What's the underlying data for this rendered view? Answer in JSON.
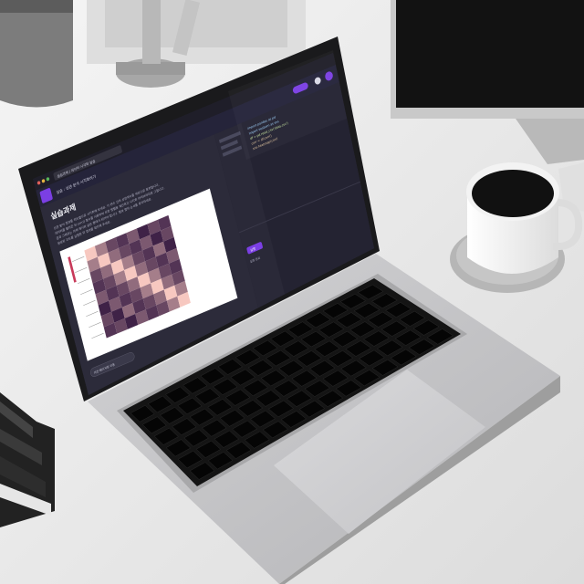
{
  "browser": {
    "tab_title": "실습과제 | 데이터 시각화 실습",
    "breadcrumb": "실습 : 상관 분석 시각화하기"
  },
  "lesson": {
    "heading": "실습과제",
    "paragraph_lines": [
      "상관 분석 결과를 히트맵으로 시각화해 보세요. 각 변수 간의 상관계수를 색상으로 표현합니다.",
      "데이터를 불러온 뒤 corr() 함수를 사용하여 상관 행렬을 계산하고 시각화 라이브러리로 그립니다.",
      "결과 그래프는 아래 예시와 같은 형태가 되어야 합니다. 행과 열의 순서를 유지하세요.",
      "완성된 코드를 실행한 뒤 결과를 확인해 주세요."
    ],
    "footer_button": "이전 페이지로 이동"
  },
  "editor": {
    "code_lines": [
      "import pandas as pd",
      "import seaborn as sns",
      "df = pd.read_csv('data.csv')",
      "corr = df.corr()",
      "sns.heatmap(corr)"
    ],
    "run_button": "실행",
    "status_text": "실행 완료"
  },
  "chart_data": {
    "type": "heatmap",
    "rows": 8,
    "cols": 8,
    "values": [
      [
        1.0,
        0.6,
        0.3,
        0.2,
        0.4,
        0.1,
        0.3,
        0.2
      ],
      [
        0.6,
        1.0,
        0.5,
        0.3,
        0.2,
        0.4,
        0.1,
        0.3
      ],
      [
        0.3,
        0.5,
        1.0,
        0.6,
        0.3,
        0.2,
        0.5,
        0.1
      ],
      [
        0.2,
        0.3,
        0.6,
        1.0,
        0.5,
        0.3,
        0.2,
        0.4
      ],
      [
        0.4,
        0.2,
        0.3,
        0.5,
        1.0,
        0.6,
        0.3,
        0.2
      ],
      [
        0.1,
        0.4,
        0.2,
        0.3,
        0.6,
        1.0,
        0.5,
        0.3
      ],
      [
        0.3,
        0.1,
        0.5,
        0.2,
        0.3,
        0.5,
        1.0,
        0.6
      ],
      [
        0.2,
        0.3,
        0.1,
        0.4,
        0.2,
        0.3,
        0.6,
        1.0
      ]
    ]
  },
  "colors": {
    "accent": "#7b3fe4",
    "screen_bg": "#2c2b3a",
    "panel_bg": "#242332",
    "heat_low": "#2a0f3a",
    "heat_high": "#f7c8c0"
  }
}
